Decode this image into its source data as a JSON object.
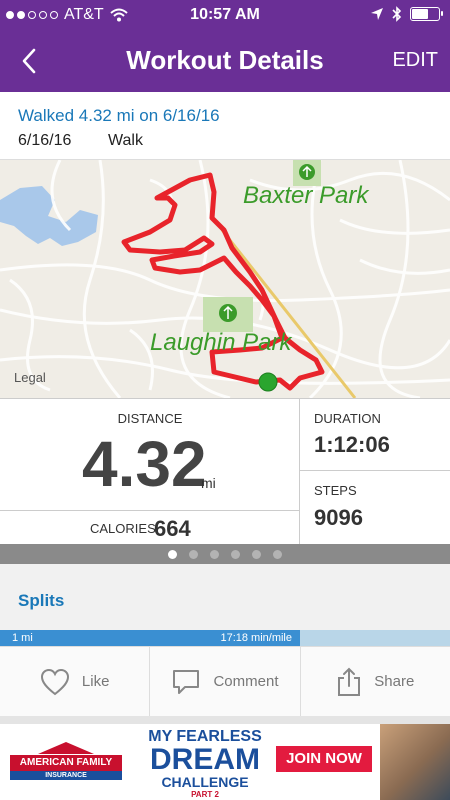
{
  "status_bar": {
    "carrier": "AT&T",
    "time": "10:57 AM",
    "signal_bars_filled": 2,
    "signal_bars_total": 5
  },
  "nav": {
    "title": "Workout Details",
    "back_icon": "chevron-left-icon",
    "edit_label": "EDIT"
  },
  "workout": {
    "title": "Walked 4.32 mi on 6/16/16",
    "date": "6/16/16",
    "activity_type": "Walk"
  },
  "map": {
    "labels": {
      "park_1": "Baxter Park",
      "park_2": "Laughin Park",
      "legal": "Legal"
    },
    "route_color": "#e8242b",
    "park_color": "#3b9b2a"
  },
  "stats": {
    "distance_label": "DISTANCE",
    "distance_value": "4.32",
    "distance_unit": "mi",
    "calories_label": "CALORIES",
    "calories_value": "664",
    "duration_label": "DURATION",
    "duration_value": "1:12:06",
    "steps_label": "STEPS",
    "steps_value": "9096"
  },
  "pager": {
    "page_count": 6,
    "active_index": 0
  },
  "splits": {
    "title": "Splits",
    "first_split_label": "1 mi",
    "first_split_pace": "17:18 min/mile"
  },
  "actions": {
    "like": "Like",
    "comment": "Comment",
    "share": "Share"
  },
  "ad": {
    "brand_line1": "AMERICAN FAMILY",
    "brand_line2": "INSURANCE",
    "headline_1": "MY FEARLESS",
    "headline_2": "DREAM",
    "headline_3": "CHALLENGE",
    "headline_4": "PART 2",
    "cta": "JOIN NOW"
  },
  "colors": {
    "brand_purple": "#6a2f96",
    "link_blue": "#1a78b8",
    "pager_gray": "#8a8a8a"
  }
}
